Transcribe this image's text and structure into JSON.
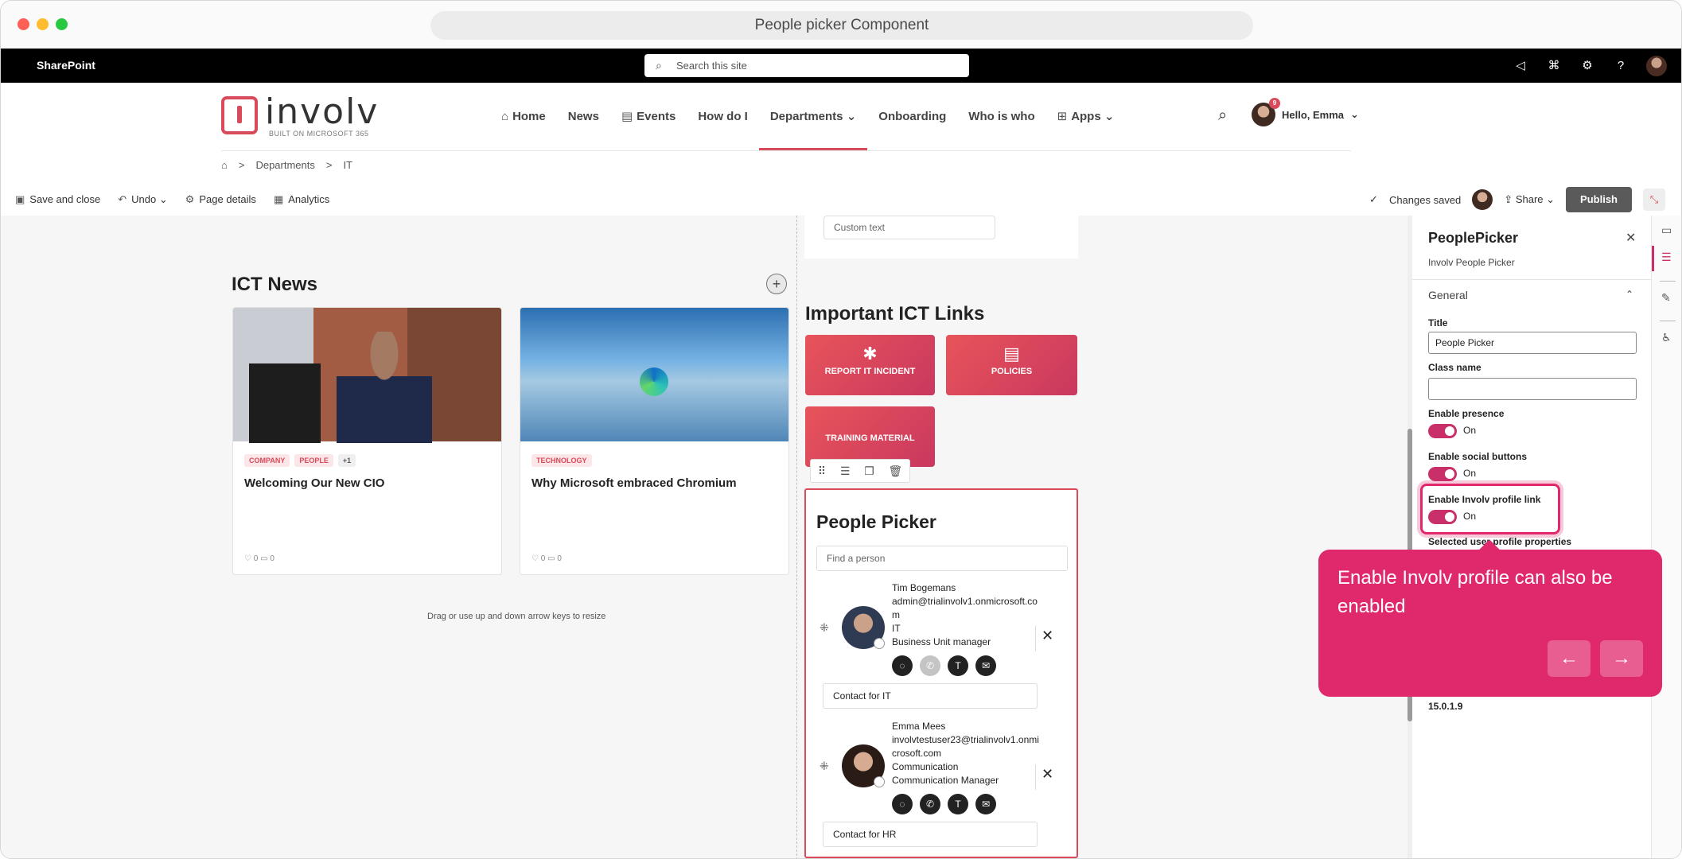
{
  "window": {
    "title": "People picker Component"
  },
  "suitebar": {
    "brand": "SharePoint",
    "search_placeholder": "Search this site"
  },
  "site": {
    "logo_text": "involv",
    "logo_sub": "BUILT ON MICROSOFT 365",
    "nav": [
      {
        "label": "Home",
        "icon": "home-icon"
      },
      {
        "label": "News"
      },
      {
        "label": "Events",
        "icon": "calendar-icon"
      },
      {
        "label": "How do I"
      },
      {
        "label": "Departments",
        "dropdown": true,
        "active": true
      },
      {
        "label": "Onboarding"
      },
      {
        "label": "Who is who"
      },
      {
        "label": "Apps",
        "icon": "apps-icon",
        "dropdown": true
      }
    ],
    "user_greeting": "Hello, Emma",
    "notification_count": "9"
  },
  "breadcrumb": {
    "sep": ">",
    "items": [
      "Departments",
      "IT"
    ]
  },
  "command_bar": {
    "save_close": "Save and close",
    "undo": "Undo",
    "page_details": "Page details",
    "analytics": "Analytics",
    "status": "Changes saved",
    "share": "Share",
    "publish": "Publish"
  },
  "news_section": {
    "title": "ICT News",
    "cards": [
      {
        "tags": [
          "COMPANY",
          "PEOPLE",
          "+1"
        ],
        "title": "Welcoming Our New CIO",
        "likes": "0",
        "comments": "0"
      },
      {
        "tags": [
          "TECHNOLOGY"
        ],
        "title": "Why Microsoft embraced Chromium",
        "likes": "0",
        "comments": "0"
      }
    ],
    "resize_hint": "Drag or use up and down arrow keys to resize"
  },
  "custom_text": {
    "value": "Custom text"
  },
  "links_section": {
    "title": "Important ICT Links",
    "tiles": [
      {
        "label": "REPORT IT INCIDENT",
        "icon": "bug-icon"
      },
      {
        "label": "POLICIES",
        "icon": "document-icon"
      },
      {
        "label": "TRAINING MATERIAL"
      }
    ]
  },
  "people_picker": {
    "title": "People Picker",
    "find_placeholder": "Find a person",
    "people": [
      {
        "name": "Tim Bogemans",
        "email": "admin@trialinvolv1.onmicrosoft.com",
        "department": "IT",
        "job": "Business Unit manager",
        "note": "Contact for IT"
      },
      {
        "name": "Emma Mees",
        "email": "involvtestuser23@trialinvolv1.onmicrosoft.com",
        "department": "Communication",
        "job": "Communication Manager",
        "note": "Contact for HR"
      }
    ]
  },
  "property_pane": {
    "title": "PeoplePicker",
    "subtitle": "Involv People Picker",
    "group": "General",
    "title_label": "Title",
    "title_value": "People Picker",
    "class_label": "Class name",
    "class_value": "",
    "presence_label": "Enable presence",
    "presence_state": "On",
    "social_label": "Enable social buttons",
    "social_state": "On",
    "profile_label": "Enable Involv profile link",
    "profile_state": "On",
    "selected_props_label": "Selected user profile properties",
    "version": "15.0.1.9"
  },
  "tooltip": {
    "text": "Enable Involv profile can also be enabled",
    "prev": "←",
    "next": "→"
  }
}
